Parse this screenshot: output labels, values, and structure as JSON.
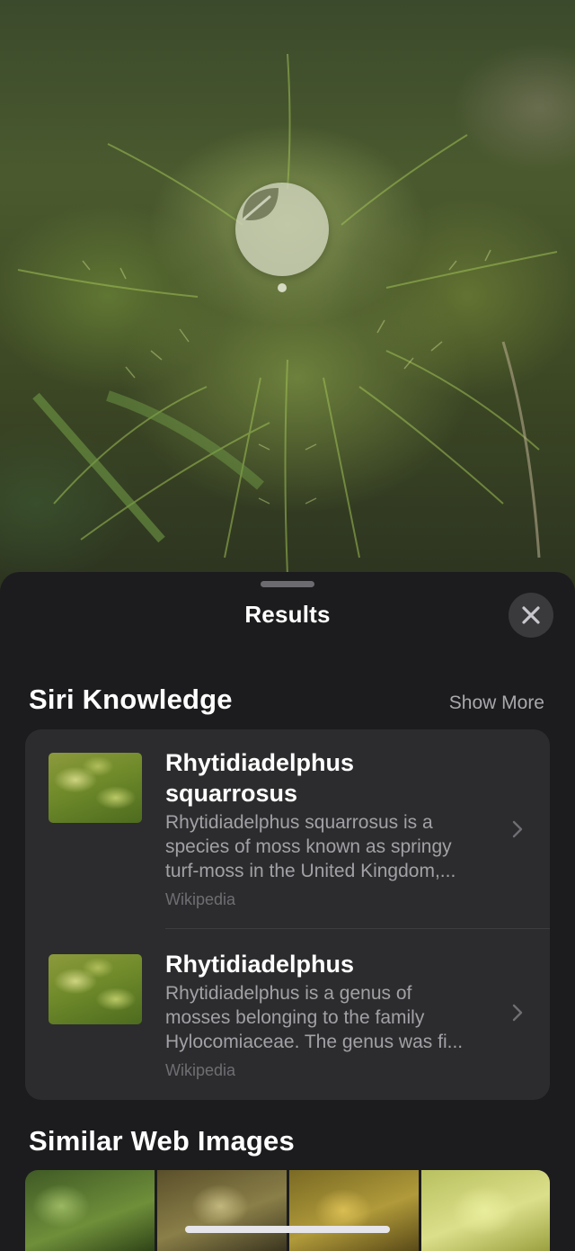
{
  "lookup": {
    "icon": "leaf-icon"
  },
  "sheet": {
    "title": "Results",
    "close_icon": "close-icon"
  },
  "siri_knowledge": {
    "heading": "Siri Knowledge",
    "show_more": "Show More",
    "results": [
      {
        "title_line1": "Rhytidiadelphus",
        "title_line2": "squarrosus",
        "desc_line1": "Rhytidiadelphus squarrosus is a",
        "desc_line2": "species of moss known as springy",
        "desc_line3": "turf-moss in the United Kingdom,...",
        "source": "Wikipedia"
      },
      {
        "title_line1": "Rhytidiadelphus",
        "desc_line1": "Rhytidiadelphus is a genus of",
        "desc_line2": "mosses belonging to the family",
        "desc_line3": "Hylocomiaceae. The genus was fi...",
        "source": "Wikipedia"
      }
    ]
  },
  "similar_images": {
    "heading": "Similar Web Images"
  },
  "colors": {
    "sheet_bg": "#1c1c1e",
    "card_bg": "#2c2c2e",
    "secondary_text": "#a1a1a6"
  }
}
